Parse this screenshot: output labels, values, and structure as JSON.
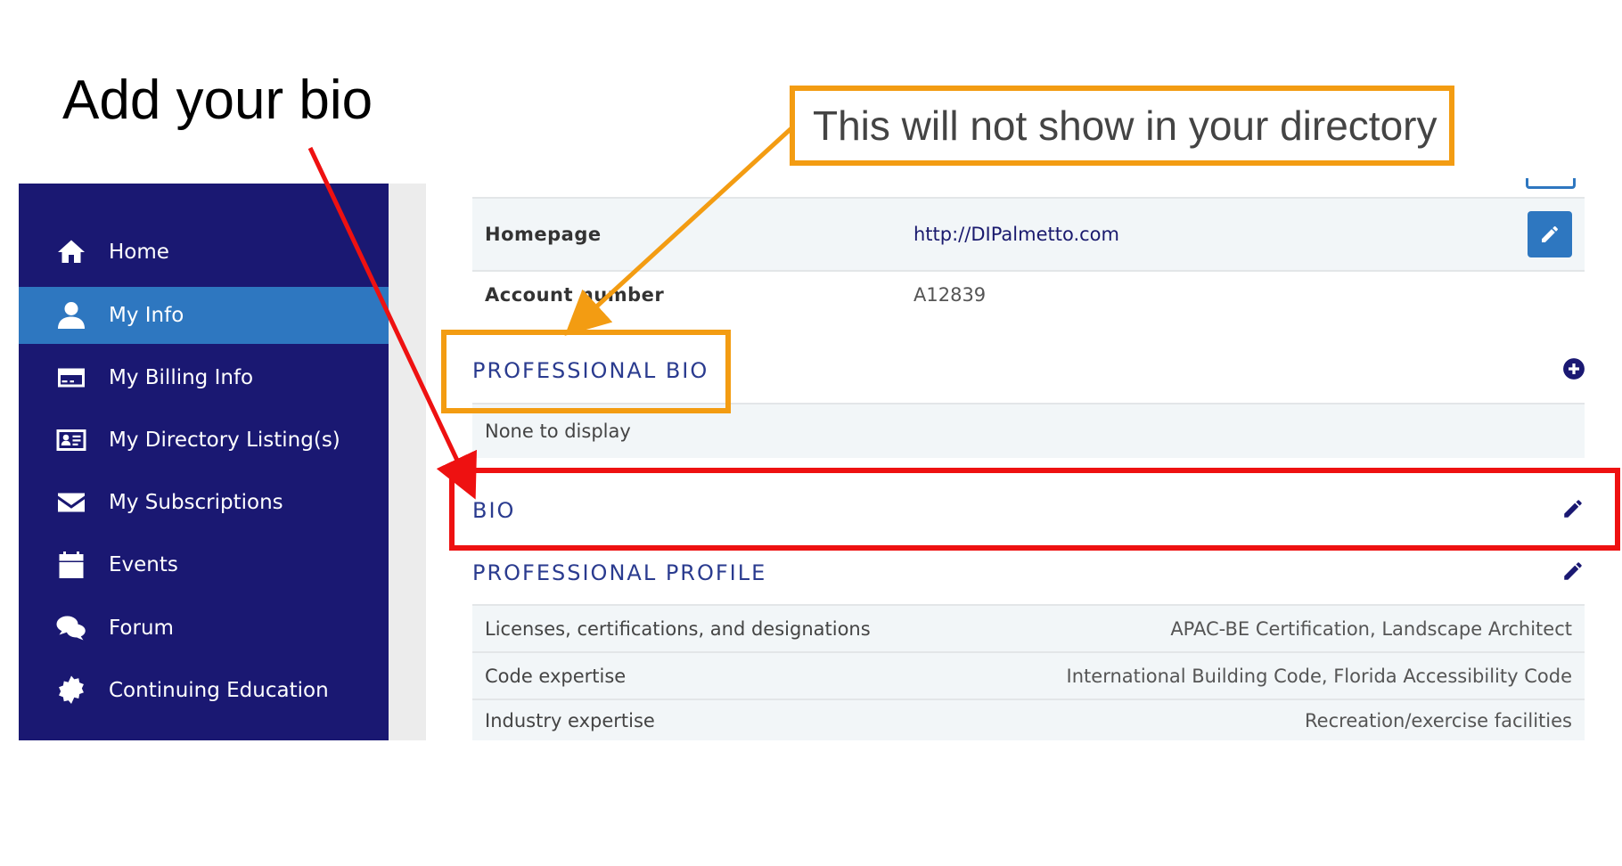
{
  "slide": {
    "title": "Add your bio",
    "callout_text": "This will not show in your directory"
  },
  "sidebar": {
    "items": [
      {
        "label": "Home",
        "icon": "home-icon"
      },
      {
        "label": "My Info",
        "icon": "user-icon",
        "active": true
      },
      {
        "label": "My Billing Info",
        "icon": "credit-card-icon"
      },
      {
        "label": "My Directory Listing(s)",
        "icon": "id-card-icon"
      },
      {
        "label": "My Subscriptions",
        "icon": "envelope-icon"
      },
      {
        "label": "Events",
        "icon": "calendar-icon"
      },
      {
        "label": "Forum",
        "icon": "comments-icon"
      },
      {
        "label": "Continuing Education",
        "icon": "certificate-icon"
      }
    ]
  },
  "account": {
    "homepage_label": "Homepage",
    "homepage_value": "http://DIPalmetto.com",
    "account_number_label": "Account number",
    "account_number_value": "A12839"
  },
  "professional_bio": {
    "heading": "PROFESSIONAL BIO",
    "empty_text": "None to display"
  },
  "bio": {
    "heading": "BIO"
  },
  "professional_profile": {
    "heading": "PROFESSIONAL PROFILE",
    "rows": [
      {
        "label": "Licenses, certifications, and designations",
        "value": "APAC-BE Certification, Landscape Architect"
      },
      {
        "label": "Code expertise",
        "value": "International Building Code, Florida Accessibility Code"
      },
      {
        "label": "Industry expertise",
        "value": "Recreation/exercise facilities"
      }
    ]
  },
  "colors": {
    "sidebar_bg": "#1a1872",
    "active_bg": "#2e77c0",
    "heading_text": "#2a3b8f",
    "callout_orange": "#f39c12",
    "highlight_red": "#ee1111"
  }
}
